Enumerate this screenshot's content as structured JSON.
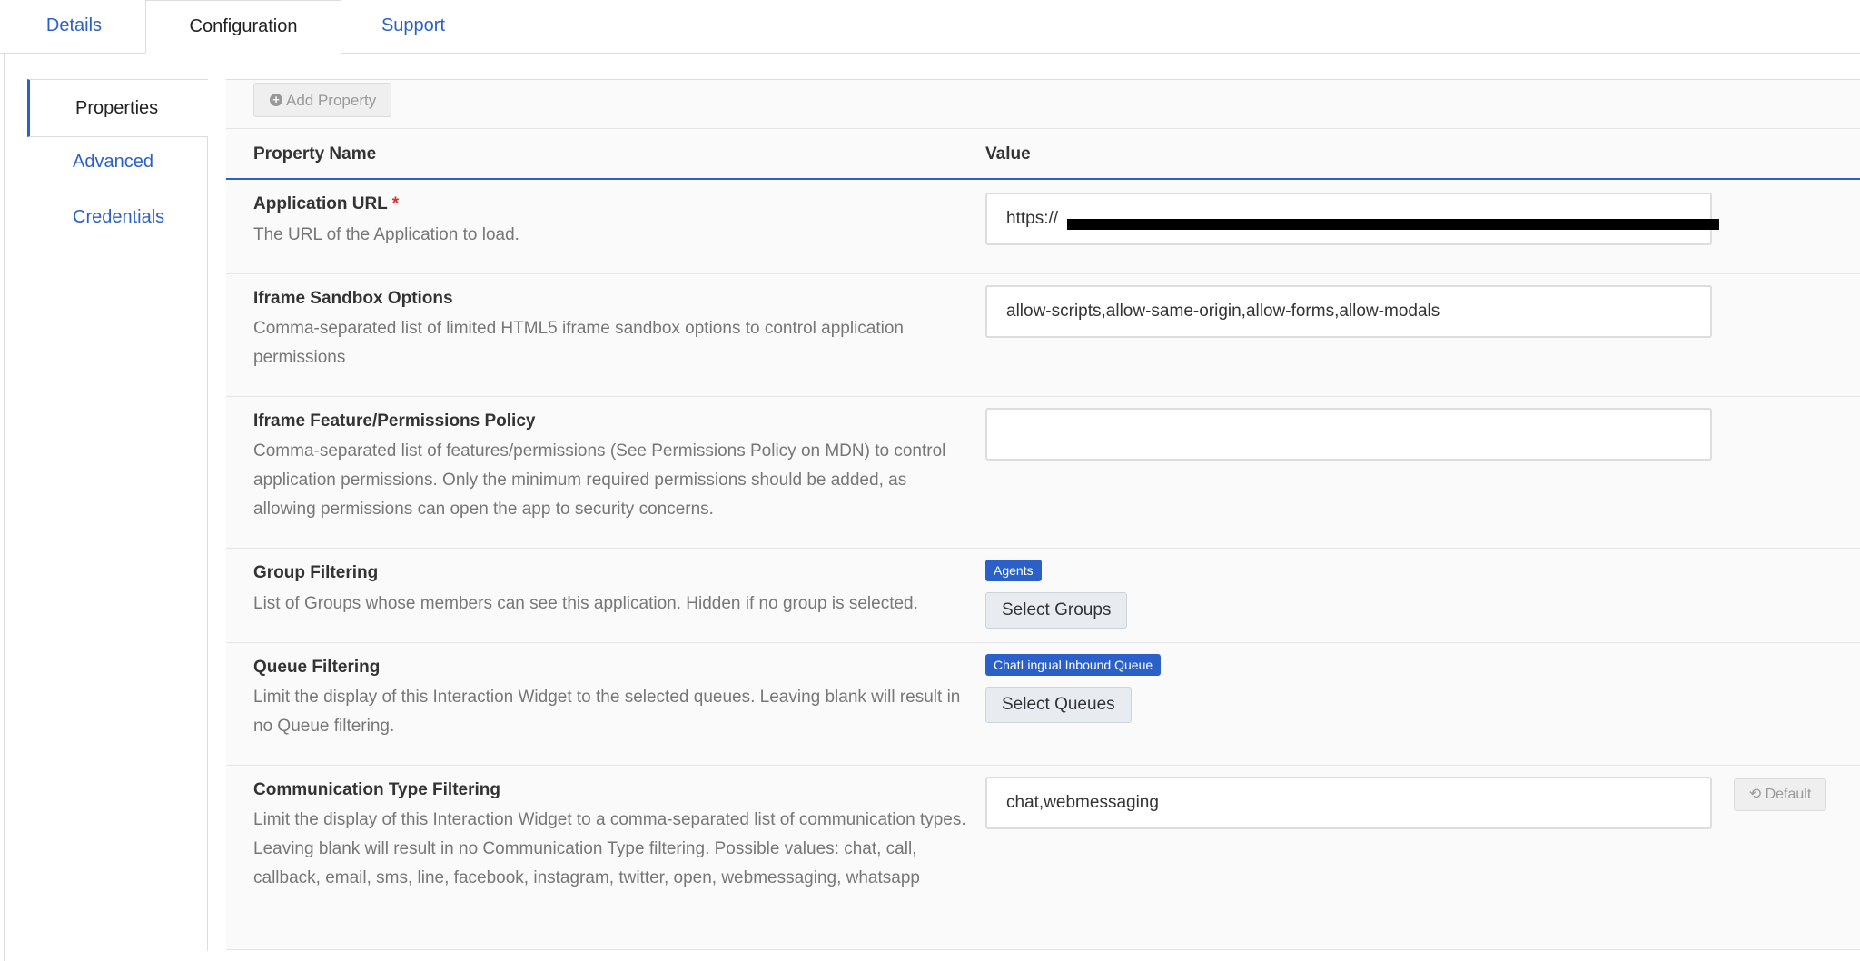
{
  "tabs": [
    {
      "label": "Details"
    },
    {
      "label": "Configuration"
    },
    {
      "label": "Support"
    }
  ],
  "subnav": [
    {
      "label": "Properties"
    },
    {
      "label": "Advanced"
    },
    {
      "label": "Credentials"
    }
  ],
  "toolbar": {
    "add_label": "Add Property"
  },
  "table": {
    "col_name": "Property Name",
    "col_value": "Value"
  },
  "rows": [
    {
      "name": "Application URL",
      "required": "*",
      "desc": "The URL of the Application to load.",
      "value": "https://"
    },
    {
      "name": "Iframe Sandbox Options",
      "desc": "Comma-separated list of limited HTML5 iframe sandbox options to control application permissions",
      "value": "allow-scripts,allow-same-origin,allow-forms,allow-modals"
    },
    {
      "name": "Iframe Feature/Permissions Policy",
      "desc": "Comma-separated list of features/permissions (See Permissions Policy on MDN) to control application permissions. Only the minimum required permissions should be added, as allowing permissions can open the app to security concerns.",
      "value": ""
    },
    {
      "name": "Group Filtering",
      "desc": "List of Groups whose members can see this application. Hidden if no group is selected.",
      "tag": "Agents",
      "button": "Select Groups"
    },
    {
      "name": "Queue Filtering",
      "desc": "Limit the display of this Interaction Widget to the selected queues. Leaving blank will result in no Queue filtering.",
      "tag": "ChatLingual Inbound Queue",
      "button": "Select Queues"
    },
    {
      "name": "Communication Type Filtering",
      "desc": "Limit the display of this Interaction Widget to a comma-separated list of communication types. Leaving blank will result in no Communication Type filtering. Possible values: chat, call, callback, email, sms, line, facebook, instagram, twitter, open, webmessaging, whatsapp",
      "value": "chat,webmessaging",
      "default_label": "Default"
    }
  ],
  "colors": {
    "accent": "#2a60c8",
    "required": "#d32f2f"
  }
}
